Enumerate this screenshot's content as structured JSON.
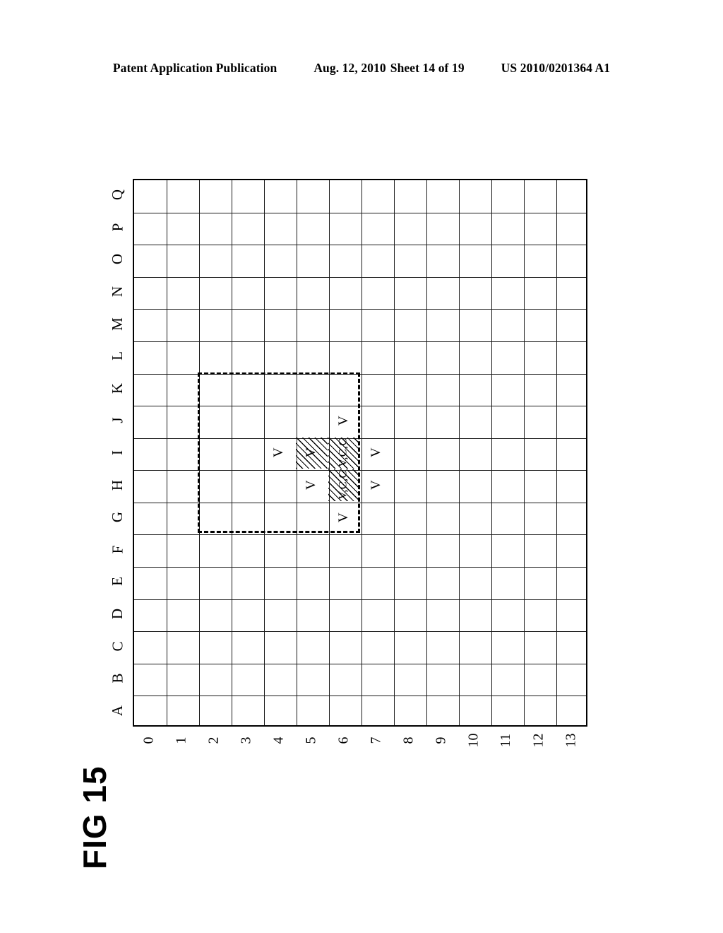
{
  "header": {
    "publication": "Patent Application Publication",
    "date": "Aug. 12, 2010",
    "sheet": "Sheet 14 of 19",
    "patent_number": "US 2010/0201364 A1"
  },
  "figure": {
    "label": "FIG 15",
    "column_labels": [
      "0",
      "1",
      "2",
      "3",
      "4",
      "5",
      "6",
      "7",
      "8",
      "9",
      "10",
      "11",
      "12",
      "13"
    ],
    "row_labels": [
      "Q",
      "P",
      "O",
      "N",
      "M",
      "L",
      "K",
      "J",
      "I",
      "H",
      "G",
      "F",
      "E",
      "D",
      "C",
      "B",
      "A"
    ],
    "grid": {
      "columns": 14,
      "rows": 17,
      "border_color": "#000000"
    },
    "selection_rect": {
      "label": "dashed-region",
      "col_start": 2,
      "col_end": 7,
      "row_start": "K",
      "row_end": "G"
    },
    "marked_cells": [
      {
        "col": 6,
        "row": "J",
        "text": "V",
        "hatched": false
      },
      {
        "col": 4,
        "row": "I",
        "text": "V",
        "hatched": false
      },
      {
        "col": 5,
        "row": "I",
        "text": "V",
        "hatched": true
      },
      {
        "col": 6,
        "row": "I",
        "text": "V,C,C",
        "hatched": true
      },
      {
        "col": 7,
        "row": "I",
        "text": "V",
        "hatched": false
      },
      {
        "col": 5,
        "row": "H",
        "text": "V",
        "hatched": false
      },
      {
        "col": 6,
        "row": "H",
        "text": "V,C,C",
        "hatched": true
      },
      {
        "col": 7,
        "row": "H",
        "text": "V",
        "hatched": false
      },
      {
        "col": 6,
        "row": "G",
        "text": "V",
        "hatched": false
      }
    ]
  }
}
